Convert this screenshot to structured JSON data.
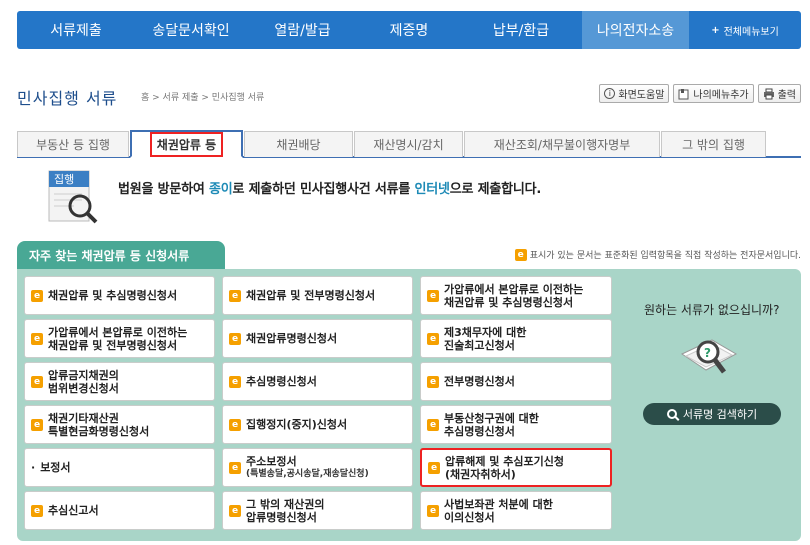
{
  "nav": {
    "items": [
      "서류제출",
      "송달문서확인",
      "열람/발급",
      "제증명",
      "납부/환급",
      "나의전자소송"
    ],
    "all_menu": "전체메뉴보기",
    "all_menu_plus": "+"
  },
  "header": {
    "title": "민사집행 서류",
    "breadcrumb": "홈 > 서류 제출 > 민사집행 서류",
    "tools": {
      "help": "화면도움말",
      "add_menu": "나의메뉴추가",
      "print": "출력"
    }
  },
  "tabs": [
    "부동산 등 집행",
    "채권압류 등",
    "채권배당",
    "재산명시/감치",
    "재산조회/채무불이행자명부",
    "그 밖의 집행"
  ],
  "intro": {
    "icon_label": "집행",
    "text_1": "법원을 방문하여 ",
    "hl_1": "종이",
    "text_2": "로 제출하던 민사집행사건 서류를 ",
    "hl_2": "인터넷",
    "text_3": "으로 제출합니다."
  },
  "section": {
    "title": "자주 찾는 채권압류 등 신청서류",
    "legend": "표시가 있는 문서는 표준화된 입력항목을 직접 작성하는 전자문서입니다."
  },
  "e_icon": "e",
  "bullet": "·",
  "docs": [
    {
      "line1": "채권압류 및 추심명령신청서",
      "line2": ""
    },
    {
      "line1": "채권압류 및 전부명령신청서",
      "line2": ""
    },
    {
      "line1": "가압류에서 본압류로 이전하는",
      "line2": "채권압류 및 추심명령신청서"
    },
    {
      "line1": "가압류에서 본압류로 이전하는",
      "line2": "채권압류 및 전부명령신청서"
    },
    {
      "line1": "채권압류명령신청서",
      "line2": ""
    },
    {
      "line1": "제3채무자에 대한",
      "line2": "진술최고신청서"
    },
    {
      "line1": "압류금지채권의",
      "line2": "범위변경신청서"
    },
    {
      "line1": "추심명령신청서",
      "line2": ""
    },
    {
      "line1": "전부명령신청서",
      "line2": ""
    },
    {
      "line1": "채권기타재산권",
      "line2": "특별현금화명령신청서"
    },
    {
      "line1": "집행정지(중지)신청서",
      "line2": ""
    },
    {
      "line1": "부동산청구권에 대한",
      "line2": "추심명령신청서"
    },
    {
      "line1": "보정서",
      "line2": ""
    },
    {
      "line1": "주소보정서",
      "line2": "(특별송달,공시송달,재송달신청)"
    },
    {
      "line1": "압류해제 및 추심포기신청",
      "line2": "(채권자취하서)"
    },
    {
      "line1": "추심신고서",
      "line2": ""
    },
    {
      "line1": "그 밖의 재산권의",
      "line2": "압류명령신청서"
    },
    {
      "line1": "사법보좌관 처분에 대한",
      "line2": "이의신청서"
    }
  ],
  "side": {
    "question": "원하는 서류가 없으십니까?",
    "search_button": "서류명 검색하기"
  },
  "colors": {
    "nav_bg": "#2476c8",
    "accent_teal": "#49a895",
    "panel_bg": "#a9d5c8",
    "highlight_red": "#e22222",
    "e_icon": "#f5a000",
    "tab_border": "#3e6fb3"
  }
}
